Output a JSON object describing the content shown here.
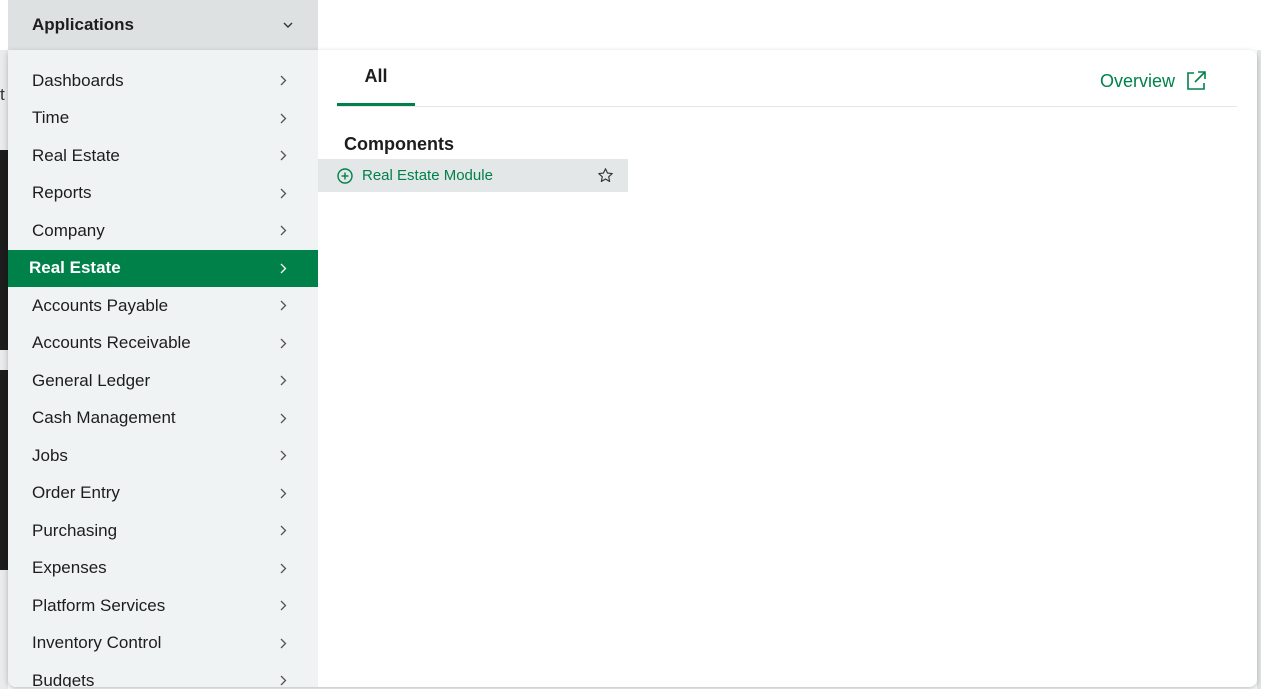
{
  "header": {
    "applications_label": "Applications"
  },
  "sidebar": {
    "items": [
      {
        "label": "Dashboards"
      },
      {
        "label": "Time"
      },
      {
        "label": "Real Estate"
      },
      {
        "label": "Reports"
      },
      {
        "label": "Company"
      },
      {
        "label": "Real Estate",
        "active": true
      },
      {
        "label": "Accounts Payable"
      },
      {
        "label": "Accounts Receivable"
      },
      {
        "label": "General Ledger"
      },
      {
        "label": "Cash Management"
      },
      {
        "label": "Jobs"
      },
      {
        "label": "Order Entry"
      },
      {
        "label": "Purchasing"
      },
      {
        "label": "Expenses"
      },
      {
        "label": "Platform Services"
      },
      {
        "label": "Inventory Control"
      },
      {
        "label": "Budgets"
      }
    ]
  },
  "main": {
    "tabs": [
      {
        "label": "All",
        "selected": true
      }
    ],
    "overview_label": "Overview",
    "section_title": "Components",
    "components": [
      {
        "label": "Real Estate Module"
      }
    ]
  },
  "background": {
    "partial_char": "t"
  },
  "colors": {
    "accent": "#00814a",
    "sidebar_bg": "#f0f3f3",
    "header_bg": "#dde1e2",
    "row_highlight": "#e3e7e8"
  },
  "icons": {
    "header_chevron": "chevron-down-icon",
    "item_chevron": "chevron-right-icon",
    "overview": "external-link-icon",
    "component_add": "plus-circle-icon",
    "favorite": "star-icon"
  }
}
